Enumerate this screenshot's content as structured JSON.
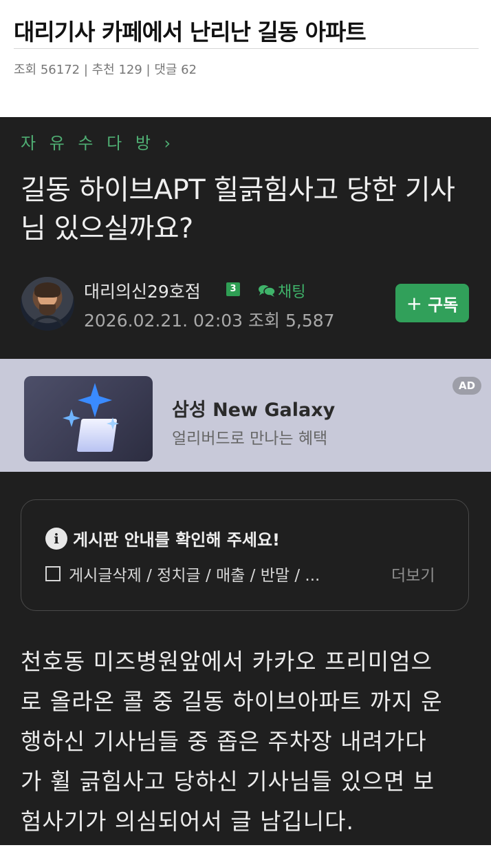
{
  "post": {
    "title": "대리기사 카페에서 난리난 길동 아파트",
    "stats": "조회 56172 | 추천 129 | 댓글 62"
  },
  "screenshot": {
    "board_link": "자 유 수 다 방 ›",
    "article_title": "길동 하이브APT 힐긁힘사고 당한 기사님 있으실까요?",
    "author": {
      "name": "대리의신29호점",
      "level": "3",
      "chat_label": "채팅",
      "meta": "2026.02.21. 02:03 조회 5,587"
    },
    "subscribe": {
      "plus": "+",
      "label": "구독"
    },
    "ad": {
      "title": "삼성 New Galaxy",
      "description": "얼리버드로 만나는 혜택",
      "badge": "AD"
    },
    "notice": {
      "title": "게시판 안내를 확인해 주세요!",
      "body": "게시글삭제 / 정치글 / 매출 / 반말 / ...",
      "more": "더보기"
    },
    "body_lines": [
      "천호동 미즈병원앞에서 카카오 프리미엄으",
      "로 올라온 콜 중 길동 하이브아파트 까지 운",
      "행하신 기사님들 중 좁은 주차장 내려가다",
      "가 휠 긁힘사고 당하신 기사님들 있으면 보",
      "험사기가 의심되어서 글 남깁니다."
    ]
  },
  "colors": {
    "dark_bg": "#1f1f1f",
    "accent_green": "#31a05a",
    "ad_bg": "#c8c9d9"
  }
}
